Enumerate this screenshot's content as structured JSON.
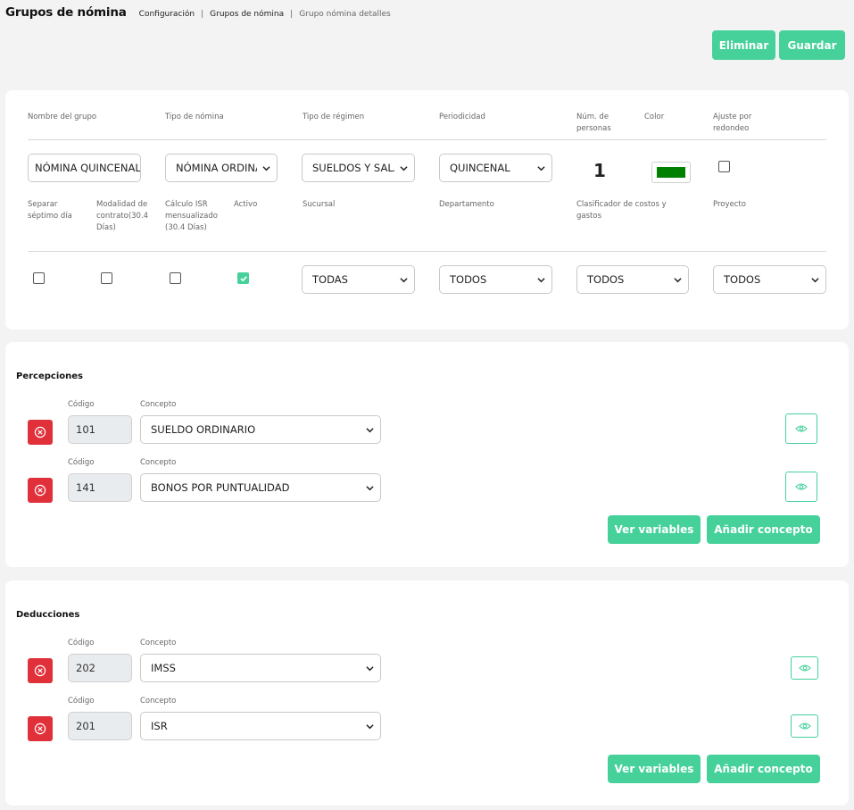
{
  "header": {
    "title": "Grupos de nómina",
    "breadcrumb": [
      "Configuración",
      "Grupos de nómina",
      "Grupo nómina detalles"
    ]
  },
  "actions": {
    "delete_label": "Eliminar",
    "save_label": "Guardar"
  },
  "general": {
    "labels": {
      "nombre": "Nombre del grupo",
      "tipo_nomina": "Tipo de nómina",
      "tipo_regimen": "Tipo de régimen",
      "periodicidad": "Periodicidad",
      "num_personas": "Núm. de personas",
      "color": "Color",
      "ajuste": "Ajuste por redondeo",
      "septimo": "Separar séptimo día",
      "modalidad": "Modalidad de contrato(30.4 Días)",
      "isr": "Cálculo ISR mensualizado (30.4 Días)",
      "activo": "Activo",
      "sucursal": "Sucursal",
      "departamento": "Departamento",
      "clasificador": "Clasificador de costos y gastos",
      "proyecto": "Proyecto"
    },
    "values": {
      "nombre": "NÓMINA QUINCENAL",
      "tipo_nomina": "NÓMINA ORDINARIA",
      "tipo_regimen": "SUELDOS Y SALARIOS",
      "periodicidad": "QUINCENAL",
      "num_personas": "1",
      "color": "#008000",
      "ajuste": false,
      "septimo": false,
      "modalidad": false,
      "isr": false,
      "activo": true,
      "sucursal": "TODAS",
      "departamento": "TODOS",
      "clasificador": "TODOS",
      "proyecto": "TODOS"
    }
  },
  "percepciones": {
    "title": "Percepciones",
    "code_label": "Código",
    "concept_label": "Concepto",
    "items": [
      {
        "code": "101",
        "concept": "SUELDO ORDINARIO"
      },
      {
        "code": "141",
        "concept": "BONOS POR PUNTUALIDAD"
      }
    ],
    "variables_label": "Ver variables",
    "add_label": "Añadir concepto"
  },
  "deducciones": {
    "title": "Deducciones",
    "code_label": "Código",
    "concept_label": "Concepto",
    "items": [
      {
        "code": "202",
        "concept": "IMSS"
      },
      {
        "code": "201",
        "concept": "ISR"
      }
    ],
    "variables_label": "Ver variables",
    "add_label": "Añadir concepto"
  },
  "colors": {
    "accent": "#46d19b",
    "danger": "#e0303a"
  },
  "icons": {
    "remove": "x-circle-icon",
    "view": "eye-icon",
    "dropdown": "chevron-down-icon",
    "check": "check-icon"
  }
}
